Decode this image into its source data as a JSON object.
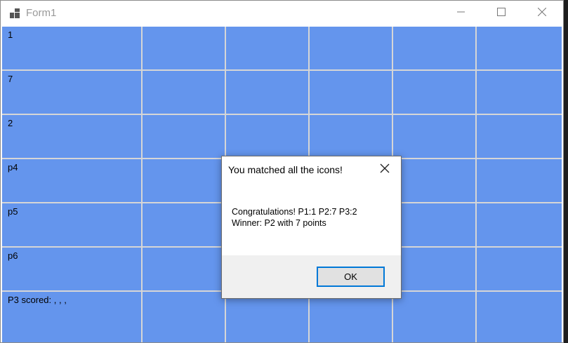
{
  "window": {
    "title": "Form1",
    "app_icon": "app-icon",
    "controls": [
      "minimize-icon",
      "maximize-icon",
      "close-icon"
    ]
  },
  "board": {
    "cell_color": "#6495ed",
    "grid_color": "#d6d6d6",
    "rows": 7,
    "columns": 6,
    "row_labels": [
      "1",
      "7",
      "2",
      "p4",
      "p5",
      "p6",
      "P3 scored: , , ,"
    ]
  },
  "dialog": {
    "title": "You matched all the icons!",
    "message_line1": "Congratulations! P1:1 P2:7 P3:2",
    "message_line2": "Winner: P2 with 7 points",
    "ok_label": "OK",
    "accent": "#0078d7"
  }
}
